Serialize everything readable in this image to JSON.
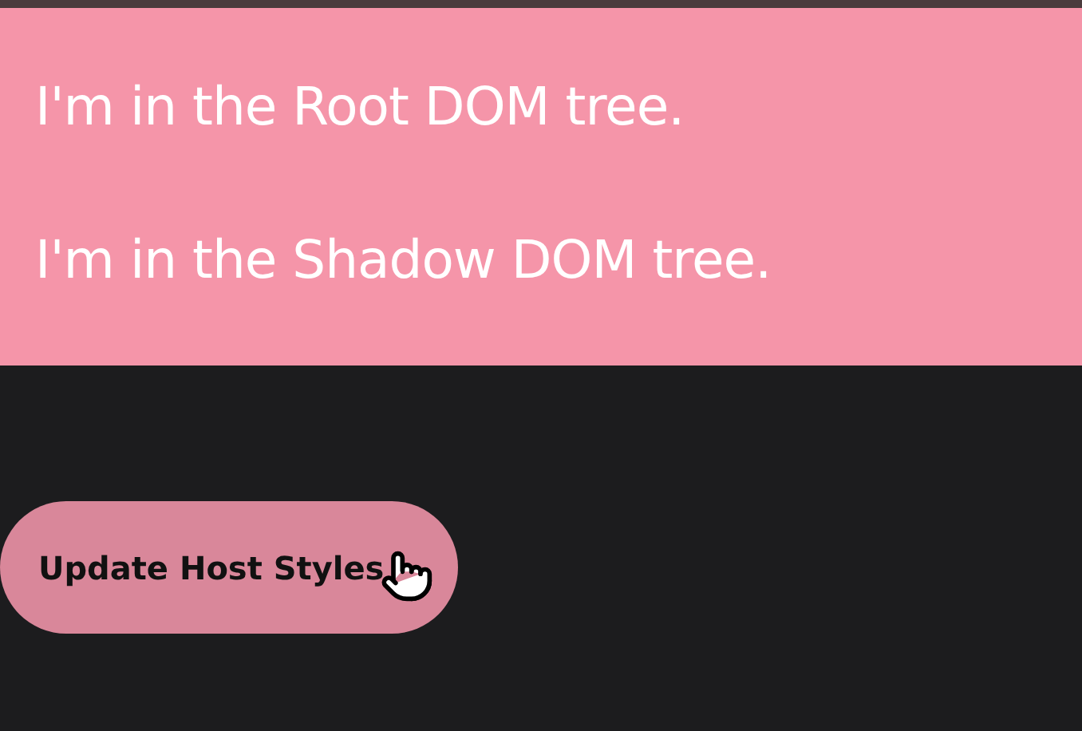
{
  "host": {
    "paragraphs": [
      "I'm in the Root DOM tree.",
      "I'm in the Shadow DOM tree."
    ]
  },
  "button": {
    "label": "Update Host Styles"
  }
}
